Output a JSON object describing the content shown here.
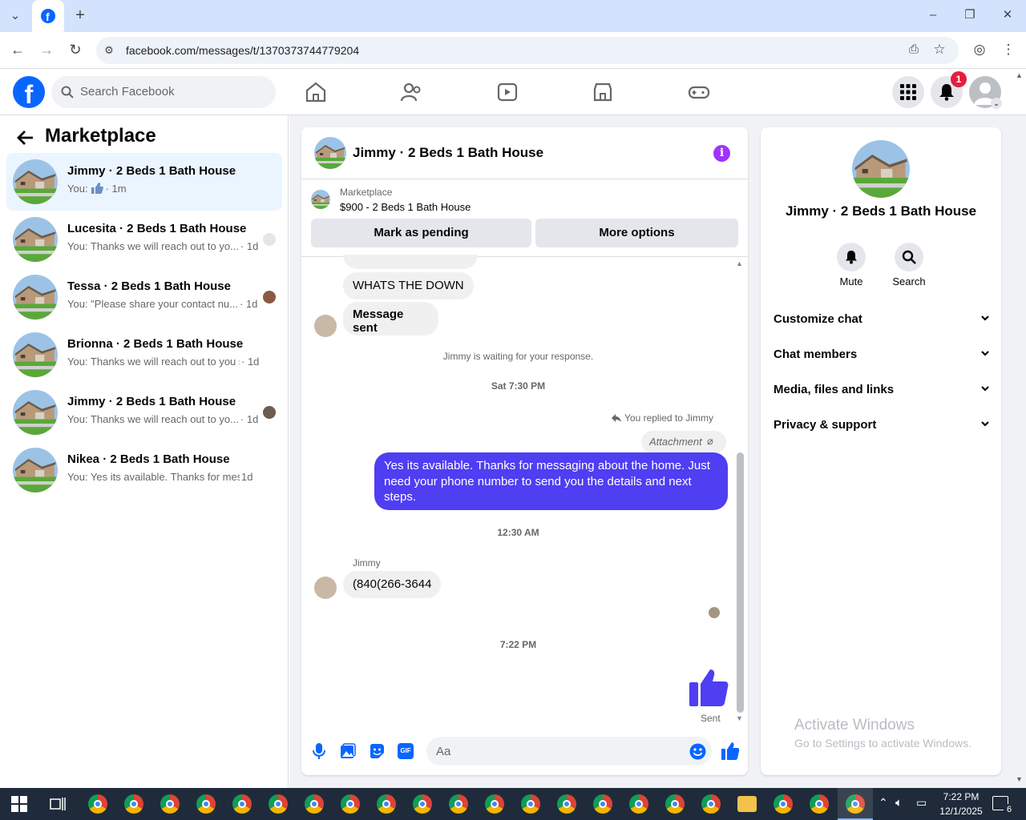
{
  "browser": {
    "url": "facebook.com/messages/t/1370373744779204",
    "tab_icon": "facebook-icon"
  },
  "header": {
    "logo": "f",
    "search_placeholder": "Search Facebook",
    "notification_count": "1"
  },
  "sidebar": {
    "title": "Marketplace",
    "conversations": [
      {
        "name": "Jimmy · 2 Beds 1 Bath House",
        "preview": "You:",
        "time": "· 1m",
        "active": true
      },
      {
        "name": "Lucesita · 2 Beds 1 Bath House",
        "preview": "You: Thanks we will reach out to yo...",
        "time": "· 1d"
      },
      {
        "name": "Tessa · 2 Beds 1 Bath House",
        "preview": "You: \"Please share your contact nu...",
        "time": "· 1d"
      },
      {
        "name": "Brionna · 2 Beds 1 Bath House",
        "preview": "You: Thanks we will reach out to you s...",
        "time": "· 1d"
      },
      {
        "name": "Jimmy · 2 Beds 1 Bath House",
        "preview": "You: Thanks we will reach out to yo...",
        "time": "· 1d"
      },
      {
        "name": "Nikea · 2 Beds 1 Bath House",
        "preview": "You: Yes its available. Thanks for mess...",
        "time": "1d"
      }
    ]
  },
  "chat": {
    "title": "Jimmy · 2 Beds 1 Bath House",
    "listing_source": "Marketplace",
    "listing_title": "$900 - 2 Beds 1 Bath House",
    "mark_pending": "Mark as pending",
    "more_options": "More options",
    "msg_whats": "WHATS THE DOWN",
    "msg_sent_label": "Message sent",
    "waiting": "Jimmy is waiting for your response.",
    "time1": "Sat 7:30 PM",
    "replied": "You replied to Jimmy",
    "attachment": "Attachment",
    "outgoing": "Yes its available. Thanks for messaging about the home. Just need your phone number to send you the details and next steps.",
    "time2": "12:30 AM",
    "sender": "Jimmy",
    "phone": "(840(266-3644",
    "time3": "7:22 PM",
    "sent_status": "Sent",
    "composer_placeholder": "Aa"
  },
  "info": {
    "title": "Jimmy · 2 Beds 1 Bath House",
    "mute": "Mute",
    "search": "Search",
    "sections": [
      "Customize chat",
      "Chat members",
      "Media, files and links",
      "Privacy & support"
    ]
  },
  "watermark": {
    "line1": "Activate Windows",
    "line2": "Go to Settings to activate Windows."
  },
  "taskbar": {
    "time": "7:22 PM",
    "date": "12/1/2025",
    "notifications": "6"
  },
  "colors": {
    "brand": "#0866ff",
    "outgoing_bubble": "#4f3ef2",
    "accent_purple": "#a033ff",
    "like": "#4f3ef2"
  }
}
